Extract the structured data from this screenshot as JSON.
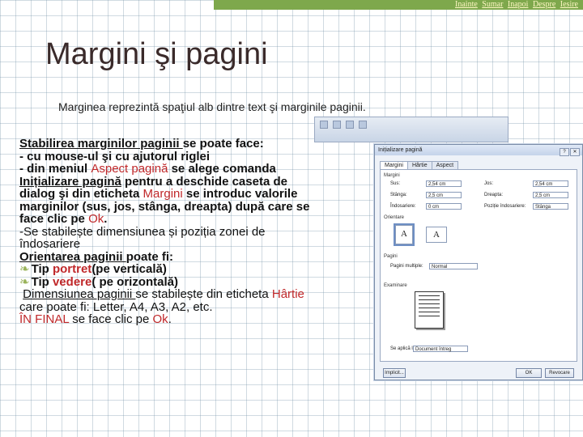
{
  "nav": {
    "links": [
      "Inainte",
      "Sumar",
      "Inapoi",
      "Despre",
      "Iesire"
    ]
  },
  "slide": {
    "title": "Margini şi pagini",
    "subtitle_term": "Marginea",
    "subtitle_rest": " reprezintă spaţiul alb dintre text şi marginile paginii.",
    "l1_u": "Stabilirea marginilor paginii ",
    "l1_rest": "se poate face:",
    "l2": "- cu mouse-ul şi cu ajutorul riglei",
    "l3_a": "- din meniul ",
    "l3_red": "Aspect pagină",
    "l3_b": " se alege comanda",
    "l4_u": "Inițializare pagină",
    "l4_b": " pentru a deschide caseta de",
    "l5_a": "dialog şi din eticheta ",
    "l5_red": "Margini ",
    "l5_b": " se introduc valorile",
    "l6": "marginilor (sus, jos, stânga, dreapta) după care se",
    "l7_a": "face clic pe ",
    "l7_red": "Ok",
    "l7_b": ".",
    "l8_a": "-Se stabilește ",
    "l8_b": "dimensiunea și poziția zonei de",
    "l9": "îndosariere",
    "l10_u": "Orientarea paginii ",
    "l10_rest": "poate fi:",
    "l11_a": "Tip ",
    "l11_red": "portret",
    "l11_b": "(pe verticală)",
    "l12_a": "Tip ",
    "l12_red": "vedere",
    "l12_b": "( pe orizontală)",
    "l13_u": "Dimensiunea paginii ",
    "l13_b": "se stabilește din eticheta ",
    "l13_red": "Hârtie",
    "l14": "care poate fi: Letter, A4, A3, A2, etc.",
    "l15_red": "ÎN FINAL",
    "l15_a": " se face clic pe ",
    "l15_red2": "Ok",
    "l15_b": "."
  },
  "dialog": {
    "title": "Inițializare pagină",
    "tabs": [
      "Margini",
      "Hârtie",
      "Aspect"
    ],
    "groups": {
      "margins": "Margini",
      "orientation": "Orientare",
      "pages": "Pagini",
      "preview": "Examinare"
    },
    "fields": {
      "top_label": "Sus:",
      "top_value": "2,54 cm",
      "bottom_label": "Jos:",
      "bottom_value": "2,54 cm",
      "left_label": "Stânga:",
      "left_value": "2,5 cm",
      "right_label": "Dreapta:",
      "right_value": "2,5 cm",
      "gutter_label": "Îndosariere:",
      "gutter_value": "0 cm",
      "gutter_pos_label": "Poziție îndosariere:",
      "gutter_pos_value": "Stânga",
      "pages_label": "Pagini multiple:",
      "pages_value": "Normal",
      "apply_label": "Se aplică la:",
      "apply_value": "Document întreg"
    },
    "orientation": {
      "portrait_glyph": "A",
      "landscape_glyph": "A"
    },
    "buttons": {
      "default": "Implicit...",
      "ok": "OK",
      "cancel": "Revocare"
    }
  }
}
